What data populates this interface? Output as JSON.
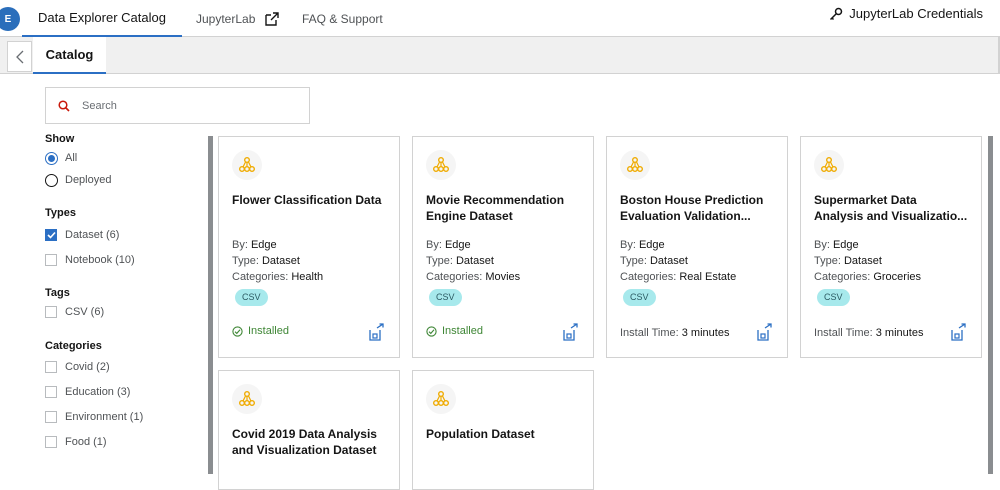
{
  "nav": {
    "logo_text": "E",
    "tabs": [
      {
        "label": "Data Explorer Catalog"
      },
      {
        "label": "JupyterLab"
      },
      {
        "label": "FAQ & Support"
      }
    ],
    "credentials_label": "JupyterLab Credentials"
  },
  "subnav": {
    "tab_label": "Catalog"
  },
  "search": {
    "placeholder": "Search"
  },
  "filters": {
    "show": {
      "title": "Show",
      "options": [
        {
          "label": "All",
          "selected": true
        },
        {
          "label": "Deployed",
          "selected": false
        }
      ]
    },
    "types": {
      "title": "Types",
      "options": [
        {
          "label": "Dataset (6)",
          "checked": true
        },
        {
          "label": "Notebook (10)",
          "checked": false
        }
      ]
    },
    "tags": {
      "title": "Tags",
      "options": [
        {
          "label": "CSV (6)",
          "checked": false
        }
      ]
    },
    "categories": {
      "title": "Categories",
      "options": [
        {
          "label": "Covid (2)",
          "checked": false
        },
        {
          "label": "Education (3)",
          "checked": false
        },
        {
          "label": "Environment (1)",
          "checked": false
        },
        {
          "label": "Food (1)",
          "checked": false
        }
      ]
    }
  },
  "labels": {
    "by": "By:",
    "type": "Type:",
    "categories": "Categories:",
    "install_time": "Install Time:"
  },
  "cards": [
    {
      "title_lines": [
        "Flower Classification Data"
      ],
      "by": "Edge",
      "type": "Dataset",
      "category": "Health",
      "tag": "CSV",
      "status": "Installed",
      "install_time": ""
    },
    {
      "title_lines": [
        "Movie Recommendation",
        "Engine Dataset"
      ],
      "by": "Edge",
      "type": "Dataset",
      "category": "Movies",
      "tag": "CSV",
      "status": "Installed",
      "install_time": ""
    },
    {
      "title_lines": [
        "Boston House Prediction",
        "Evaluation Validation..."
      ],
      "by": "Edge",
      "type": "Dataset",
      "category": "Real Estate",
      "tag": "CSV",
      "status": "",
      "install_time": "3 minutes"
    },
    {
      "title_lines": [
        "Supermarket Data",
        "Analysis and Visualizatio..."
      ],
      "by": "Edge",
      "type": "Dataset",
      "category": "Groceries",
      "tag": "CSV",
      "status": "",
      "install_time": "3 minutes"
    },
    {
      "title_lines": [
        "Covid 2019 Data Analysis",
        "and Visualization Dataset"
      ],
      "by": "",
      "type": "",
      "category": "",
      "tag": "",
      "status": "",
      "install_time": ""
    },
    {
      "title_lines": [
        "Population Dataset"
      ],
      "by": "",
      "type": "",
      "category": "",
      "tag": "",
      "status": "",
      "install_time": ""
    }
  ],
  "colors": {
    "accent": "#2b6fc4",
    "installed": "#3e8635",
    "chip": "#a7e9ec",
    "icon": "#f0ab00"
  }
}
